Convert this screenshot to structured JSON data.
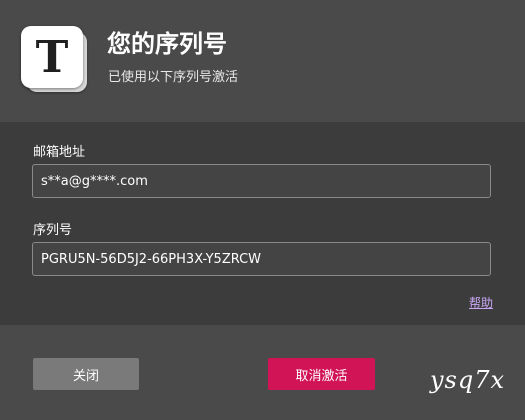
{
  "dialog": {
    "app_icon_letter": "T",
    "title": "您的序列号",
    "subtitle": "已使用以下序列号激活"
  },
  "form": {
    "email_label": "邮箱地址",
    "email_value": "s**a@g****.com",
    "serial_label": "序列号",
    "serial_value": "PGRU5N-56D5J2-66PH3X-Y5ZRCW",
    "help_link": "帮助"
  },
  "footer": {
    "close_label": "关闭",
    "deactivate_label": "取消激活",
    "watermark": "ysq7x"
  },
  "colors": {
    "header_bg": "#4a4a4a",
    "body_bg": "#3c3c3c",
    "primary_button": "#d11455",
    "secondary_button": "#7a7a7a",
    "link": "#c9a7f5"
  }
}
